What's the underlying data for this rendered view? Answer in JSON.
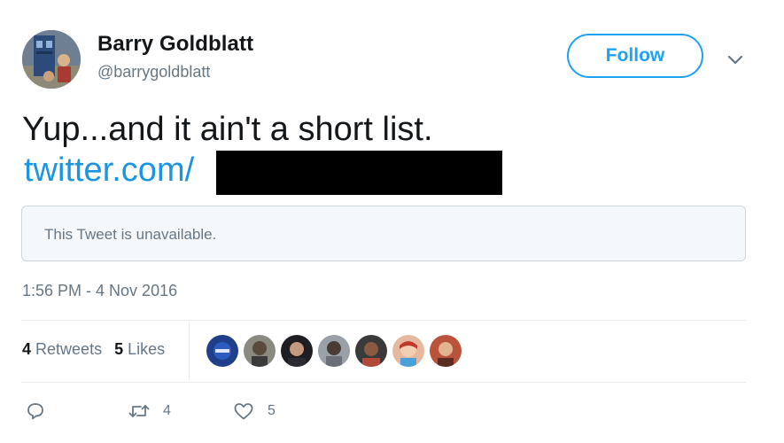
{
  "user": {
    "name": "Barry Goldblatt",
    "handle": "@barrygoldblatt"
  },
  "follow_button": {
    "label": "Follow"
  },
  "tweet": {
    "text": "Yup...and it ain't a short list.",
    "link_text": "twitter.com/",
    "quoted_tweet_text": "This Tweet is unavailable.",
    "timestamp": "1:56 PM - 4 Nov 2016"
  },
  "stats": {
    "retweets_count": "4",
    "retweets_label": "Retweets",
    "likes_count": "5",
    "likes_label": "Likes"
  },
  "actions": {
    "reply_count": "",
    "retweet_count": "4",
    "like_count": "5"
  },
  "colors": {
    "accent": "#1da1f2",
    "link": "#1b95e0",
    "text": "#14171a",
    "muted": "#657786",
    "border": "#e6ecf0",
    "quote_bg": "#f5f8fa"
  },
  "icons": {
    "reply": "speech-bubble-icon",
    "retweet": "retweet-arrows-icon",
    "like": "heart-icon",
    "more": "chevron-down-icon"
  }
}
